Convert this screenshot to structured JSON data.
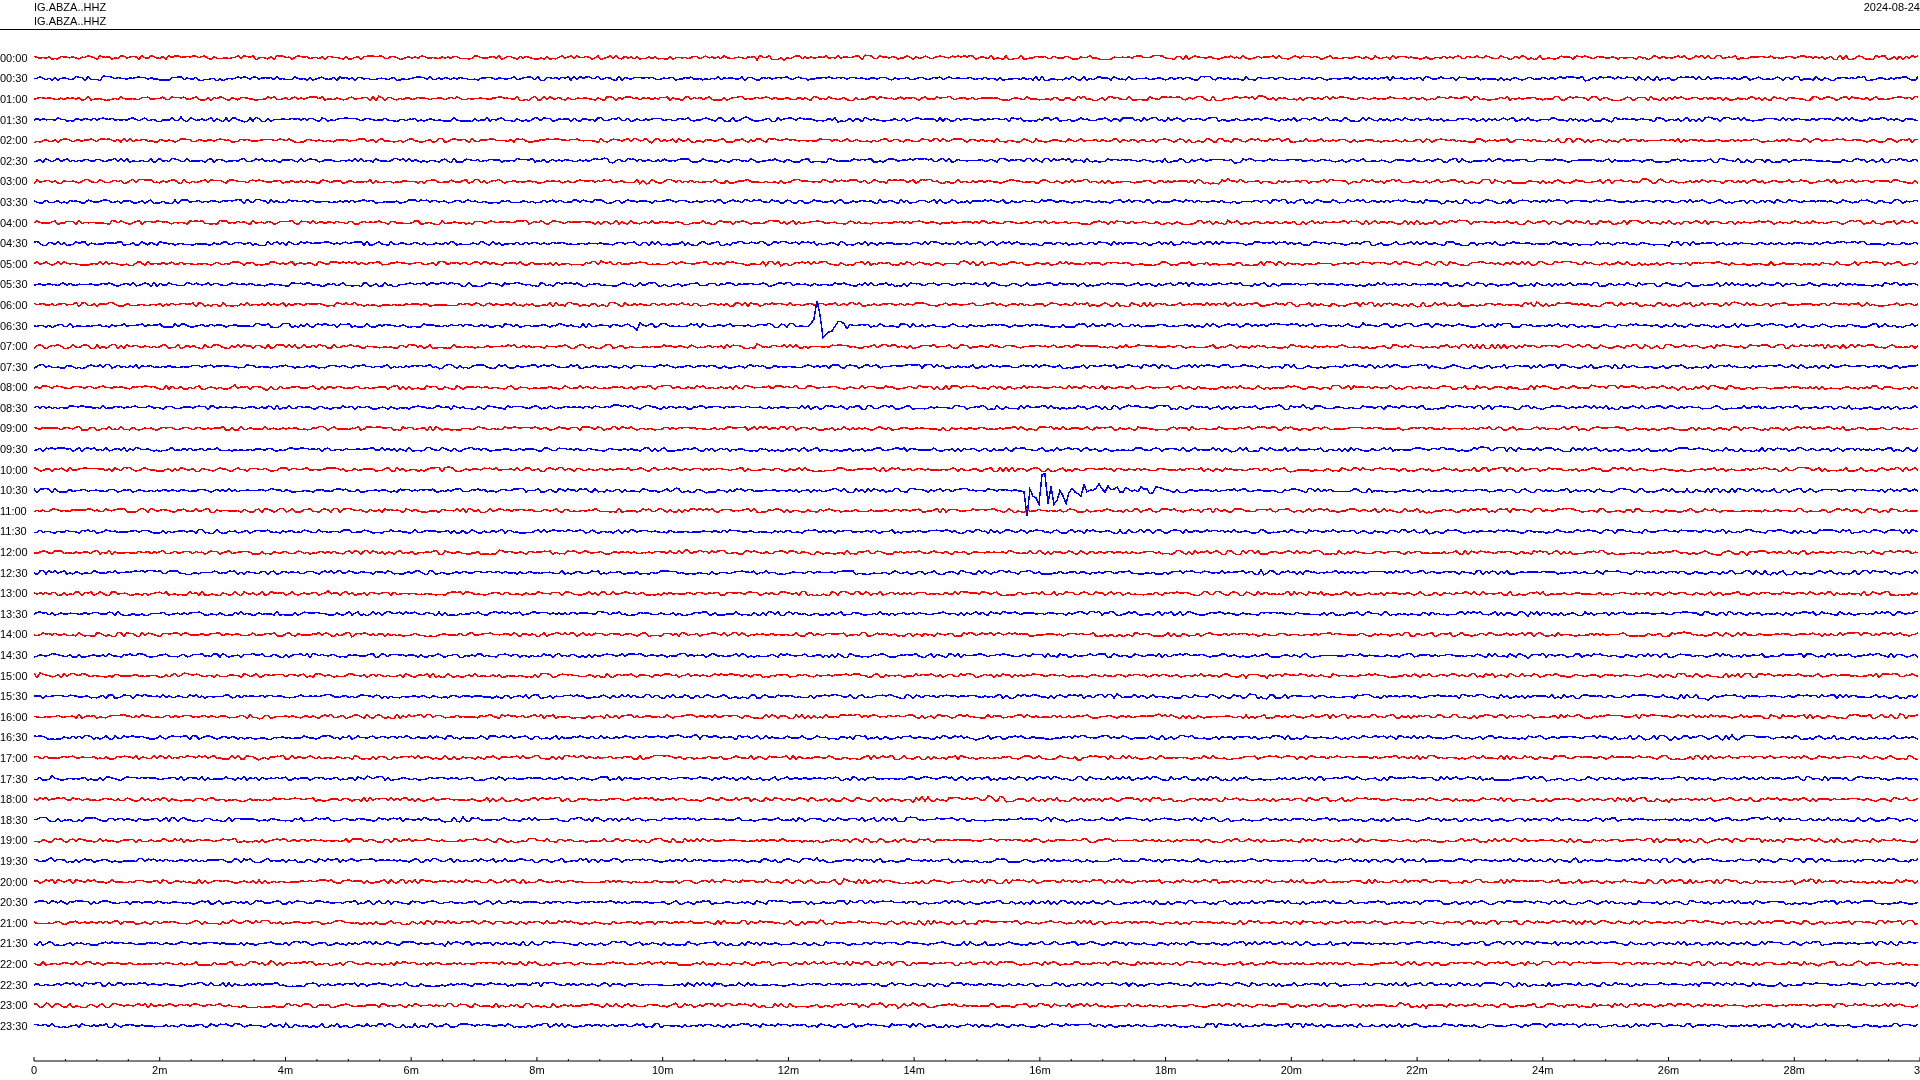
{
  "header": {
    "station_lines": [
      "IG.ABZA..HHZ",
      "IG.ABZA..HHZ"
    ],
    "date": "2024-08-24"
  },
  "traces": [
    {
      "time": "00:00",
      "color": "#ff0000"
    },
    {
      "time": "00:30",
      "color": "#0000ff"
    },
    {
      "time": "01:00",
      "color": "#ff0000"
    },
    {
      "time": "01:30",
      "color": "#0000ff"
    },
    {
      "time": "02:00",
      "color": "#ff0000"
    },
    {
      "time": "02:30",
      "color": "#0000ff"
    },
    {
      "time": "03:00",
      "color": "#ff0000"
    },
    {
      "time": "03:30",
      "color": "#0000ff"
    },
    {
      "time": "04:00",
      "color": "#ff0000"
    },
    {
      "time": "04:30",
      "color": "#0000ff"
    },
    {
      "time": "05:00",
      "color": "#ff0000"
    },
    {
      "time": "05:30",
      "color": "#0000ff"
    },
    {
      "time": "06:00",
      "color": "#ff0000"
    },
    {
      "time": "06:30",
      "color": "#0000ff"
    },
    {
      "time": "07:00",
      "color": "#ff0000"
    },
    {
      "time": "07:30",
      "color": "#0000ff"
    },
    {
      "time": "08:00",
      "color": "#ff0000"
    },
    {
      "time": "08:30",
      "color": "#0000ff"
    },
    {
      "time": "09:00",
      "color": "#ff0000"
    },
    {
      "time": "09:30",
      "color": "#0000ff"
    },
    {
      "time": "10:00",
      "color": "#ff0000"
    },
    {
      "time": "10:30",
      "color": "#0000ff"
    },
    {
      "time": "11:00",
      "color": "#ff0000"
    },
    {
      "time": "11:30",
      "color": "#0000ff"
    },
    {
      "time": "12:00",
      "color": "#ff0000"
    },
    {
      "time": "12:30",
      "color": "#0000ff"
    },
    {
      "time": "13:00",
      "color": "#ff0000"
    },
    {
      "time": "13:30",
      "color": "#0000ff"
    },
    {
      "time": "14:00",
      "color": "#ff0000"
    },
    {
      "time": "14:30",
      "color": "#0000ff"
    },
    {
      "time": "15:00",
      "color": "#ff0000"
    },
    {
      "time": "15:30",
      "color": "#0000ff"
    },
    {
      "time": "16:00",
      "color": "#ff0000"
    },
    {
      "time": "16:30",
      "color": "#0000ff"
    },
    {
      "time": "17:00",
      "color": "#ff0000"
    },
    {
      "time": "17:30",
      "color": "#0000ff"
    },
    {
      "time": "18:00",
      "color": "#ff0000"
    },
    {
      "time": "18:30",
      "color": "#0000ff"
    },
    {
      "time": "19:00",
      "color": "#ff0000"
    },
    {
      "time": "19:30",
      "color": "#0000ff"
    },
    {
      "time": "20:00",
      "color": "#ff0000"
    },
    {
      "time": "20:30",
      "color": "#0000ff"
    },
    {
      "time": "21:00",
      "color": "#ff0000"
    },
    {
      "time": "21:30",
      "color": "#0000ff"
    },
    {
      "time": "22:00",
      "color": "#ff0000"
    },
    {
      "time": "22:30",
      "color": "#0000ff"
    },
    {
      "time": "23:00",
      "color": "#ff0000"
    },
    {
      "time": "23:30",
      "color": "#0000ff"
    }
  ],
  "time_axis": {
    "labels": [
      "0",
      "2m",
      "4m",
      "6m",
      "8m",
      "10m",
      "12m",
      "14m",
      "16m",
      "18m",
      "20m",
      "22m",
      "24m",
      "26m",
      "28m",
      "3"
    ]
  }
}
